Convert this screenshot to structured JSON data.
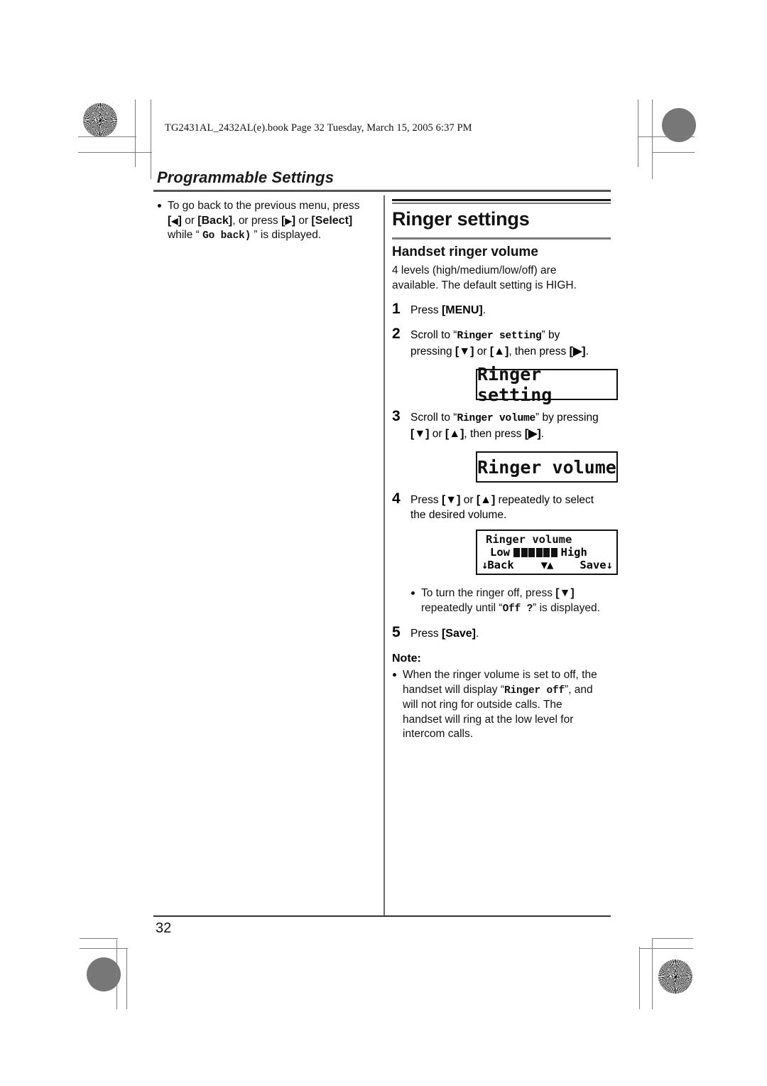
{
  "header": {
    "file_stamp": "TG2431AL_2432AL(e).book  Page 32  Tuesday, March 15, 2005  6:37 PM",
    "chapter_title": "Programmable Settings"
  },
  "left_column": {
    "bullet": {
      "line1_a": "To go back to the previous menu, press",
      "line2_key1": "[",
      "line2_arrow_left": "◀",
      "line2_key1b": "]",
      "line2_or1": " or ",
      "line2_back": "[Back]",
      "line2_or2": ", or press ",
      "line2_key2": "[",
      "line2_arrow_right": "▶",
      "line2_key2b": "]",
      "line2_or3": " or ",
      "line2_select": "[Select]",
      "line3_pre": "while “ ",
      "line3_mono": "Go back)",
      "line3_post": " ” is displayed."
    }
  },
  "right_column": {
    "section_title": "Ringer settings",
    "sub_title": "Handset ringer volume",
    "intro_line1": "4 levels (high/medium/low/off) are",
    "intro_line2": "available. The default setting is HIGH.",
    "steps": [
      {
        "num": "1",
        "pre": "Press ",
        "key": "[MENU]",
        "post": "."
      },
      {
        "num": "2",
        "pre": "Scroll to “",
        "mono": "Ringer setting",
        "mid": "” by",
        "line2_pre": "pressing ",
        "line2_k1": "[▼]",
        "line2_or": " or ",
        "line2_k2": "[▲]",
        "line2_mid": ", then press ",
        "line2_k3": "[▶]",
        "line2_post": "."
      },
      {
        "num": "3",
        "pre": "Scroll to “",
        "mono": "Ringer volume",
        "mid": "” by pressing",
        "line2_k1": "[▼]",
        "line2_or": " or ",
        "line2_k2": "[▲]",
        "line2_mid": ", then press ",
        "line2_k3": "[▶]",
        "line2_post": "."
      },
      {
        "num": "4",
        "pre": "Press ",
        "k1": "[▼]",
        "or": " or ",
        "k2": "[▲]",
        "post": " repeatedly to select",
        "line2": "the desired volume."
      },
      {
        "num": "5",
        "pre": "Press ",
        "key": "[Save]",
        "post": "."
      }
    ],
    "lcd_ringer_setting": "Ringer setting",
    "lcd_ringer_volume": "Ringer volume",
    "lcd_volume_panel": {
      "title": "Ringer volume",
      "low_label": "Low",
      "high_label": "High",
      "bars_filled": 6,
      "softkey_left": "Back",
      "softkey_arrows": "▼▲",
      "softkey_right": "Save",
      "arrow_left_marker": "↓",
      "arrow_right_marker": "↓"
    },
    "off_bullet": {
      "line1_pre": "To turn the ringer off, press ",
      "line1_key": "[▼]",
      "line2_pre": "repeatedly until “",
      "line2_mono": "Off ?",
      "line2_post": "” is displayed."
    },
    "note_heading": "Note:",
    "note_bullet": {
      "l1": "When the ringer volume is set to off, the",
      "l2_pre": "handset will display “",
      "l2_mono": "Ringer off",
      "l2_post": "”, and",
      "l3": "will not ring for outside calls. The",
      "l4": "handset will ring at the low level for",
      "l5": "intercom calls."
    }
  },
  "footer": {
    "page_number": "32"
  },
  "colors": {
    "text": "#111111",
    "rule_gray": "#7a7a7a",
    "rule_dark": "#1d1d1d",
    "page_bg": "#ffffff"
  }
}
